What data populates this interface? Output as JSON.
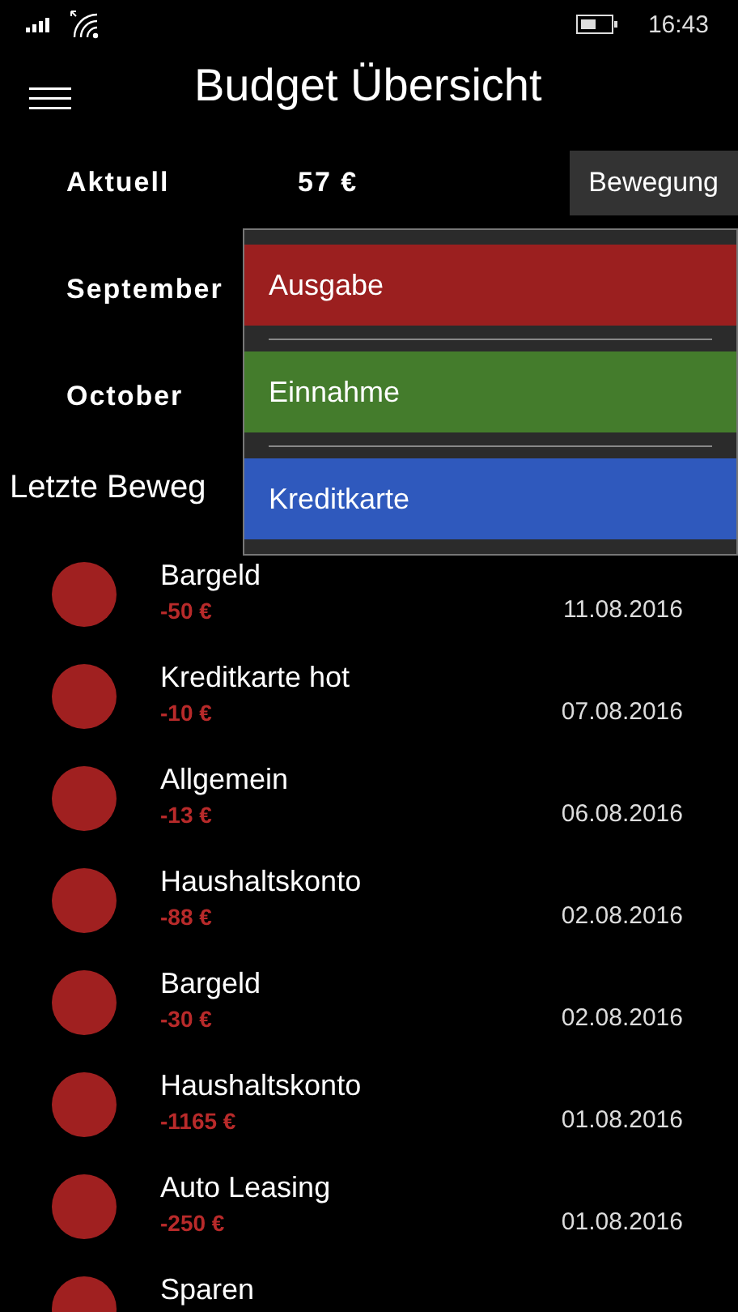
{
  "status_bar": {
    "time": "16:43"
  },
  "header": {
    "title": "Budget Übersicht"
  },
  "summary": [
    {
      "label": "Aktuell",
      "value": "57 €"
    },
    {
      "label": "September"
    },
    {
      "label": "October"
    }
  ],
  "action_button": {
    "label": "Bewegung"
  },
  "flyout": {
    "items": [
      {
        "label": "Ausgabe",
        "color": "#9b1f1f"
      },
      {
        "label": "Einnahme",
        "color": "#447c2c"
      },
      {
        "label": "Kreditkarte",
        "color": "#2f59bd"
      }
    ]
  },
  "section_title": "Letzte Beweg",
  "transactions": [
    {
      "name": "Bargeld",
      "amount": "-50 €",
      "date": "11.08.2016"
    },
    {
      "name": "Kreditkarte hot",
      "amount": "-10 €",
      "date": "07.08.2016"
    },
    {
      "name": "Allgemein",
      "amount": "-13 €",
      "date": "06.08.2016"
    },
    {
      "name": "Haushaltskonto",
      "amount": "-88 €",
      "date": "02.08.2016"
    },
    {
      "name": "Bargeld",
      "amount": "-30 €",
      "date": "02.08.2016"
    },
    {
      "name": "Haushaltskonto",
      "amount": "-1165 €",
      "date": "01.08.2016"
    },
    {
      "name": "Auto Leasing",
      "amount": "-250 €",
      "date": "01.08.2016"
    },
    {
      "name": "Sparen"
    }
  ]
}
